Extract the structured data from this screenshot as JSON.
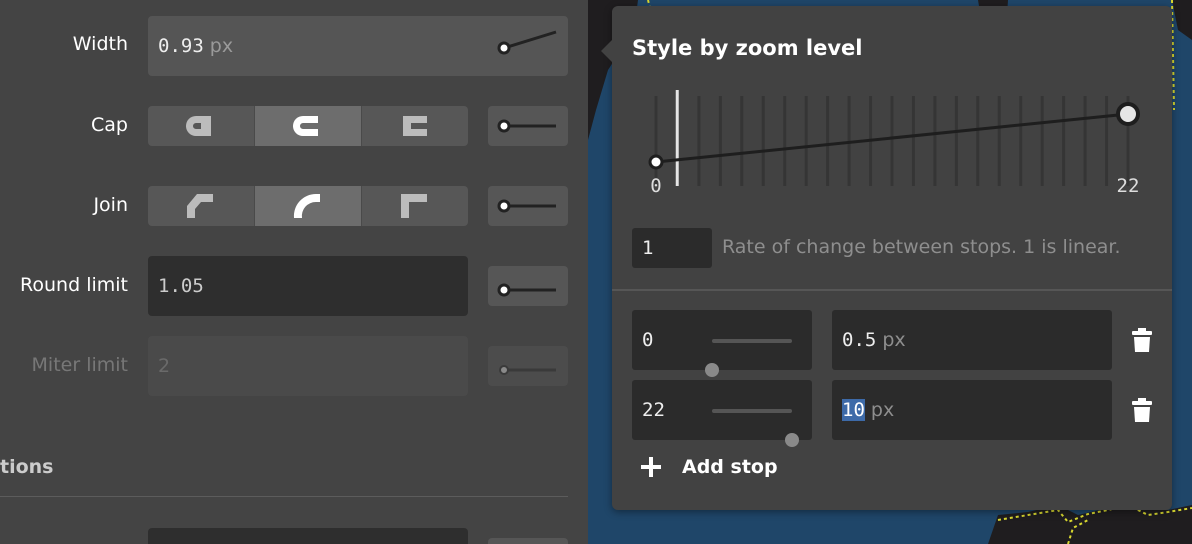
{
  "colors": {
    "background": "#444444",
    "input_dark": "#2b2b2b",
    "input_light": "#555555",
    "accent_selection": "#3d6aa8",
    "map_water": "#1f4669"
  },
  "left_panel": {
    "width": {
      "label": "Width",
      "value": "0.93",
      "unit": "px"
    },
    "cap": {
      "label": "Cap",
      "options": [
        "butt",
        "round",
        "square"
      ],
      "selected": "round"
    },
    "join": {
      "label": "Join",
      "options": [
        "bevel",
        "round",
        "miter"
      ],
      "selected": "round"
    },
    "round_limit": {
      "label": "Round limit",
      "value": "1.05"
    },
    "miter_limit": {
      "label": "Miter limit",
      "value": "2"
    },
    "section_header": "tions"
  },
  "popover": {
    "title": "Style by zoom level",
    "graph": {
      "min_label": "0",
      "max_label": "22",
      "current_zoom_fraction": 0.045,
      "stops": [
        {
          "zoom": 0,
          "value": 0.5
        },
        {
          "zoom": 22,
          "value": 10
        }
      ]
    },
    "rate": {
      "value": "1",
      "description": "Rate of change between stops. 1 is linear."
    },
    "stops": [
      {
        "zoom": "0",
        "value": "0.5",
        "unit": "px",
        "slider_fraction": 0.0
      },
      {
        "zoom": "22",
        "value": "10",
        "unit": "px",
        "slider_fraction": 1.0
      }
    ],
    "add_stop_label": "Add stop"
  }
}
